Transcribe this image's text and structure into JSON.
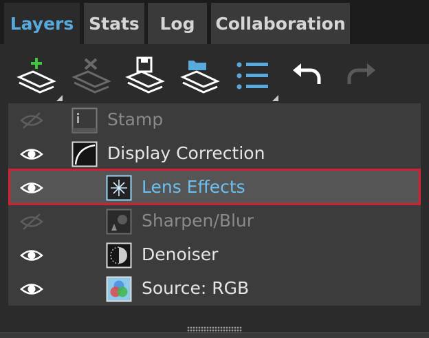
{
  "tabs": [
    {
      "label": "Layers",
      "active": true
    },
    {
      "label": "Stats",
      "active": false
    },
    {
      "label": "Log",
      "active": false
    },
    {
      "label": "Collaboration",
      "active": false
    }
  ],
  "toolbar": {
    "buttons": [
      {
        "name": "add-layer",
        "icon": "add-layer-icon",
        "enabled": true
      },
      {
        "name": "delete-layer",
        "icon": "delete-layer-icon",
        "enabled": false
      },
      {
        "name": "save-layers",
        "icon": "save-layers-icon",
        "enabled": true
      },
      {
        "name": "open-layers",
        "icon": "open-layers-icon",
        "enabled": true
      },
      {
        "name": "layer-list",
        "icon": "list-icon",
        "enabled": true
      },
      {
        "name": "undo",
        "icon": "undo-icon",
        "enabled": true
      },
      {
        "name": "redo",
        "icon": "redo-icon",
        "enabled": false
      }
    ]
  },
  "layers": [
    {
      "label": "Stamp",
      "visible": false,
      "enabled": false,
      "icon": "stamp-icon",
      "selected": false
    },
    {
      "label": "Display Correction",
      "visible": true,
      "enabled": true,
      "icon": "curve-icon",
      "selected": false
    },
    {
      "label": "Lens Effects",
      "visible": true,
      "enabled": true,
      "icon": "sparkle-icon",
      "selected": true
    },
    {
      "label": "Sharpen/Blur",
      "visible": false,
      "enabled": false,
      "icon": "sharpen-icon",
      "selected": false
    },
    {
      "label": "Denoiser",
      "visible": true,
      "enabled": true,
      "icon": "denoise-icon",
      "selected": false
    },
    {
      "label": "Source: RGB",
      "visible": true,
      "enabled": true,
      "icon": "rgb-source-icon",
      "selected": false
    }
  ],
  "colors": {
    "accent": "#58a9dc",
    "selected_text": "#6cc0ef",
    "highlight_outline": "#d42030",
    "add_green": "#3fc53f"
  }
}
